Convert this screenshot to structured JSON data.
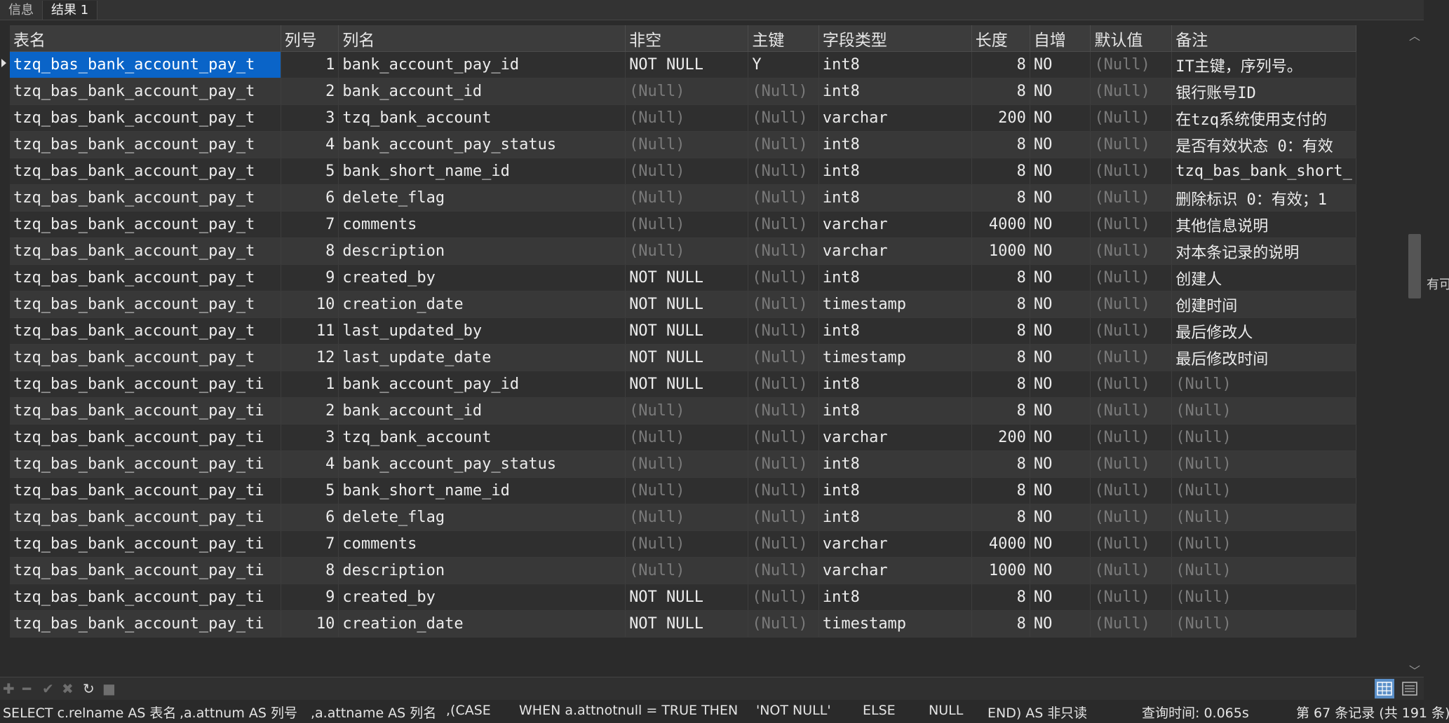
{
  "tabs": [
    {
      "label": "信息"
    },
    {
      "label": "结果 1"
    }
  ],
  "columns": [
    "表名",
    "列号",
    "列名",
    "非空",
    "主键",
    "字段类型",
    "长度",
    "自增",
    "默认值",
    "备注"
  ],
  "rows": [
    [
      "tzq_bas_bank_account_pay_t",
      "1",
      "bank_account_pay_id",
      "NOT NULL",
      "Y",
      "int8",
      "8",
      "NO",
      "(Null)",
      "IT主键，序列号。"
    ],
    [
      "tzq_bas_bank_account_pay_t",
      "2",
      "bank_account_id",
      "(Null)",
      "(Null)",
      "int8",
      "8",
      "NO",
      "(Null)",
      "银行账号ID"
    ],
    [
      "tzq_bas_bank_account_pay_t",
      "3",
      "tzq_bank_account",
      "(Null)",
      "(Null)",
      "varchar",
      "200",
      "NO",
      "(Null)",
      "在tzq系统使用支付的"
    ],
    [
      "tzq_bas_bank_account_pay_t",
      "4",
      "bank_account_pay_status",
      "(Null)",
      "(Null)",
      "int8",
      "8",
      "NO",
      "(Null)",
      "是否有效状态 0：有效"
    ],
    [
      "tzq_bas_bank_account_pay_t",
      "5",
      "bank_short_name_id",
      "(Null)",
      "(Null)",
      "int8",
      "8",
      "NO",
      "(Null)",
      "tzq_bas_bank_short_"
    ],
    [
      "tzq_bas_bank_account_pay_t",
      "6",
      "delete_flag",
      "(Null)",
      "(Null)",
      "int8",
      "8",
      "NO",
      "(Null)",
      "删除标识 0：有效；1"
    ],
    [
      "tzq_bas_bank_account_pay_t",
      "7",
      "comments",
      "(Null)",
      "(Null)",
      "varchar",
      "4000",
      "NO",
      "(Null)",
      "其他信息说明"
    ],
    [
      "tzq_bas_bank_account_pay_t",
      "8",
      "description",
      "(Null)",
      "(Null)",
      "varchar",
      "1000",
      "NO",
      "(Null)",
      "对本条记录的说明"
    ],
    [
      "tzq_bas_bank_account_pay_t",
      "9",
      "created_by",
      "NOT NULL",
      "(Null)",
      "int8",
      "8",
      "NO",
      "(Null)",
      "创建人"
    ],
    [
      "tzq_bas_bank_account_pay_t",
      "10",
      "creation_date",
      "NOT NULL",
      "(Null)",
      "timestamp",
      "8",
      "NO",
      "(Null)",
      "创建时间"
    ],
    [
      "tzq_bas_bank_account_pay_t",
      "11",
      "last_updated_by",
      "NOT NULL",
      "(Null)",
      "int8",
      "8",
      "NO",
      "(Null)",
      "最后修改人"
    ],
    [
      "tzq_bas_bank_account_pay_t",
      "12",
      "last_update_date",
      "NOT NULL",
      "(Null)",
      "timestamp",
      "8",
      "NO",
      "(Null)",
      "最后修改时间"
    ],
    [
      "tzq_bas_bank_account_pay_ti",
      "1",
      "bank_account_pay_id",
      "NOT NULL",
      "(Null)",
      "int8",
      "8",
      "NO",
      "(Null)",
      "(Null)"
    ],
    [
      "tzq_bas_bank_account_pay_ti",
      "2",
      "bank_account_id",
      "(Null)",
      "(Null)",
      "int8",
      "8",
      "NO",
      "(Null)",
      "(Null)"
    ],
    [
      "tzq_bas_bank_account_pay_ti",
      "3",
      "tzq_bank_account",
      "(Null)",
      "(Null)",
      "varchar",
      "200",
      "NO",
      "(Null)",
      "(Null)"
    ],
    [
      "tzq_bas_bank_account_pay_ti",
      "4",
      "bank_account_pay_status",
      "(Null)",
      "(Null)",
      "int8",
      "8",
      "NO",
      "(Null)",
      "(Null)"
    ],
    [
      "tzq_bas_bank_account_pay_ti",
      "5",
      "bank_short_name_id",
      "(Null)",
      "(Null)",
      "int8",
      "8",
      "NO",
      "(Null)",
      "(Null)"
    ],
    [
      "tzq_bas_bank_account_pay_ti",
      "6",
      "delete_flag",
      "(Null)",
      "(Null)",
      "int8",
      "8",
      "NO",
      "(Null)",
      "(Null)"
    ],
    [
      "tzq_bas_bank_account_pay_ti",
      "7",
      "comments",
      "(Null)",
      "(Null)",
      "varchar",
      "4000",
      "NO",
      "(Null)",
      "(Null)"
    ],
    [
      "tzq_bas_bank_account_pay_ti",
      "8",
      "description",
      "(Null)",
      "(Null)",
      "varchar",
      "1000",
      "NO",
      "(Null)",
      "(Null)"
    ],
    [
      "tzq_bas_bank_account_pay_ti",
      "9",
      "created_by",
      "NOT NULL",
      "(Null)",
      "int8",
      "8",
      "NO",
      "(Null)",
      "(Null)"
    ],
    [
      "tzq_bas_bank_account_pay_ti",
      "10",
      "creation_date",
      "NOT NULL",
      "(Null)",
      "timestamp",
      "8",
      "NO",
      "(Null)",
      "(Null)"
    ]
  ],
  "side_text": "有可",
  "status": {
    "sql_parts": [
      "SELECT c.relname AS 表名",
      ",a.attnum AS 列号",
      ",a.attname AS 列名",
      ",(CASE",
      "WHEN a.attnotnull = TRUE THEN",
      "'NOT NULL'",
      "ELSE",
      "NULL",
      "END) AS 非"
    ],
    "readonly": "只读",
    "query_time": "查询时间: 0.065s",
    "record_info": "第 67 条记录 (共 191 条)"
  },
  "icons": [
    "up-arrow-icon",
    "down-arrow-icon",
    "add-icon",
    "remove-icon",
    "check-icon",
    "cancel-icon",
    "refresh-icon",
    "stop-icon",
    "grid-view-icon",
    "form-view-icon"
  ]
}
